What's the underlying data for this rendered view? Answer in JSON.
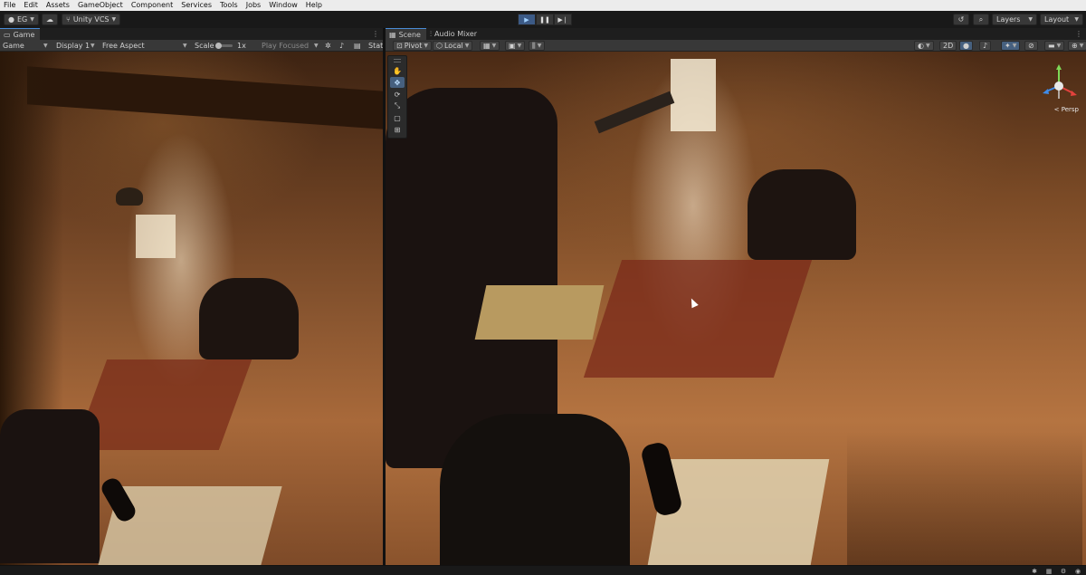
{
  "menu": [
    "File",
    "Edit",
    "Assets",
    "GameObject",
    "Component",
    "Services",
    "Tools",
    "Jobs",
    "Window",
    "Help"
  ],
  "toolbar": {
    "account_label": "EG",
    "vcs_label": "Unity VCS",
    "layers_label": "Layers",
    "layout_label": "Layout",
    "play_state": "playing"
  },
  "game": {
    "tab_label": "Game",
    "mode_label": "Game",
    "display_label": "Display 1",
    "aspect_label": "Free Aspect",
    "scale_label": "Scale",
    "scale_value": "1x",
    "play_focused_label": "Play Focused",
    "stats_label": "Stats"
  },
  "scene": {
    "tabs": [
      "Scene",
      "Audio Mixer"
    ],
    "pivot_label": "Pivot",
    "local_label": "Local",
    "mode_2d_label": "2D",
    "persp_label": "< Persp"
  },
  "colors": {
    "accent": "#4a8bd6",
    "play_active": "#3c5a86",
    "panel_bg": "#282828",
    "toolbar_bg": "#191919"
  }
}
